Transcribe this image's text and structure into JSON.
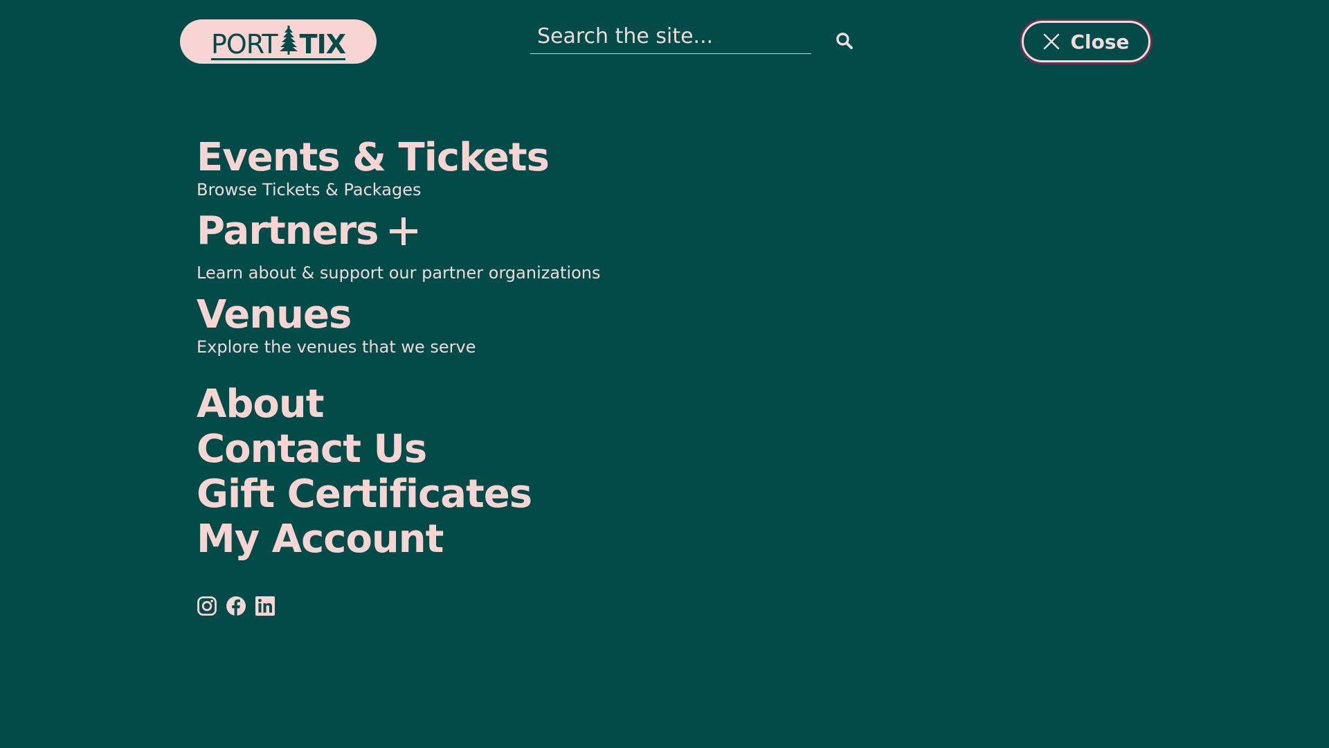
{
  "header": {
    "logo": {
      "text_light": "PORT",
      "text_bold": "TIX",
      "icon": "pine-tree-icon"
    },
    "search": {
      "placeholder": "Search the site...",
      "value": "",
      "icon": "search-icon"
    },
    "close": {
      "label": "Close",
      "icon": "close-icon"
    }
  },
  "menu": {
    "primary": [
      {
        "title": "Events & Tickets",
        "subtitle": "Browse Tickets & Packages"
      },
      {
        "title": "Partners",
        "subtitle": "Learn about & support our partner organizations",
        "icon": "plus-icon"
      },
      {
        "title": "Venues",
        "subtitle": "Explore the venues that we serve"
      }
    ],
    "secondary": [
      "About",
      "Contact Us",
      "Gift Certificates",
      "My Account"
    ]
  },
  "social": [
    "instagram-icon",
    "facebook-icon",
    "linkedin-icon"
  ],
  "colors": {
    "background": "#034b48",
    "accent": "#f8d4d3",
    "focus_ring": "#6b2f4a"
  }
}
